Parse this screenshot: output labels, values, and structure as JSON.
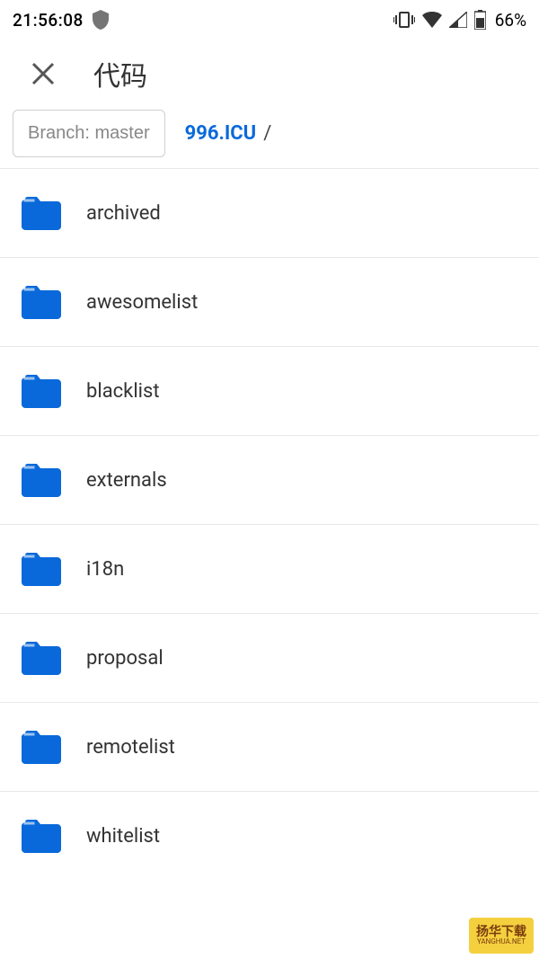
{
  "status": {
    "time": "21:56:08",
    "battery": "66%"
  },
  "header": {
    "title": "代码"
  },
  "nav": {
    "branch_label": "Branch: master",
    "repo_name": "996.ICU",
    "separator": "/"
  },
  "files": [
    {
      "name": "archived"
    },
    {
      "name": "awesomelist"
    },
    {
      "name": "blacklist"
    },
    {
      "name": "externals"
    },
    {
      "name": "i18n"
    },
    {
      "name": "proposal"
    },
    {
      "name": "remotelist"
    },
    {
      "name": "whitelist"
    }
  ],
  "watermark": {
    "top": "扬华下载",
    "bottom": "YANGHUA.NET"
  }
}
